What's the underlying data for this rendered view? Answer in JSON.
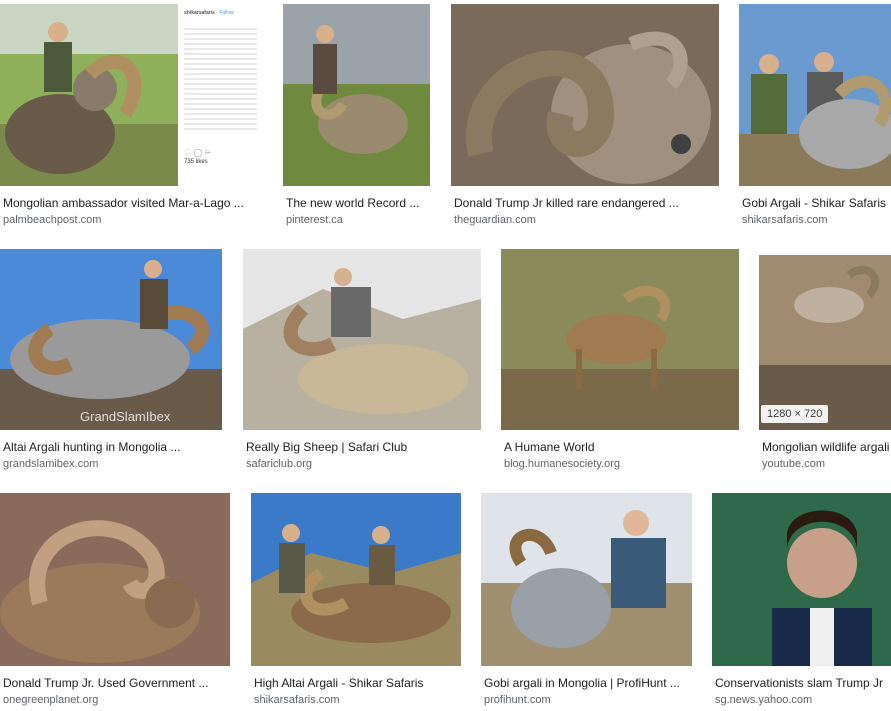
{
  "results": [
    {
      "caption": "Mongolian ambassador visited Mar-a-Lago ...",
      "source": "palmbeachpost.com"
    },
    {
      "caption": "The new world Record ...",
      "source": "pinterest.ca"
    },
    {
      "caption": "Donald Trump Jr killed rare endangered ...",
      "source": "theguardian.com"
    },
    {
      "caption": "Gobi Argali - Shikar Safaris",
      "source": "shikarsafaris.com"
    },
    {
      "caption": "Altai Argali hunting in Mongolia ...",
      "source": "grandslamibex.com",
      "watermark": "GrandSlamIbex"
    },
    {
      "caption": "Really Big Sheep | Safari Club",
      "source": "safariclub.org"
    },
    {
      "caption": "A Humane World",
      "source": "blog.humanesociety.org"
    },
    {
      "caption": "Mongolian wildlife argali",
      "source": "youtube.com",
      "dimensions": "1280 × 720"
    },
    {
      "caption": "Donald Trump Jr. Used Government ...",
      "source": "onegreenplanet.org"
    },
    {
      "caption": "High Altai Argali - Shikar Safaris",
      "source": "shikarsafaris.com"
    },
    {
      "caption": "Gobi argali in Mongolia | ProfiHunt ...",
      "source": "profihunt.com"
    },
    {
      "caption": "Conservationists slam Trump Jr",
      "source": "sg.news.yahoo.com"
    }
  ],
  "instagram_panel": {
    "username": "shikarsafaris",
    "follow": "Follow",
    "likes": "735 likes"
  }
}
